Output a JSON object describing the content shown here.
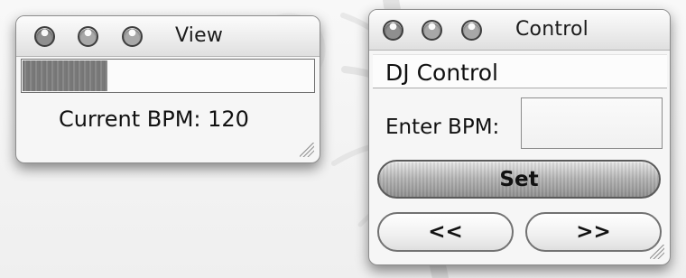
{
  "view_window": {
    "title": "View",
    "bpm_text": "Current BPM: 120",
    "beat_progress": 0.29
  },
  "control_window": {
    "title": "Control",
    "header": "DJ Control",
    "bpm_label": "Enter BPM:",
    "bpm_input_value": "",
    "set_label": "Set",
    "prev_label": "<<",
    "next_label": ">>"
  },
  "theme": {
    "window_background": "#f6f6f6",
    "button_dark": "#8f8f8f",
    "button_light": "#efefef"
  }
}
